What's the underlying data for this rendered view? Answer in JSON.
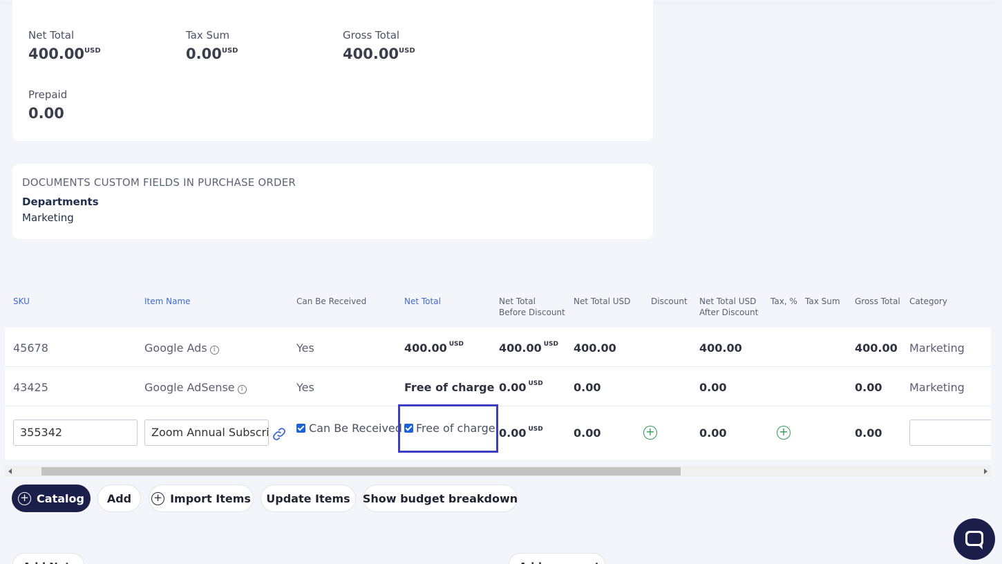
{
  "totals": {
    "net_total": {
      "label": "Net Total",
      "value": "400.00",
      "currency": "USD"
    },
    "tax_sum": {
      "label": "Tax Sum",
      "value": "0.00",
      "currency": "USD"
    },
    "gross_total": {
      "label": "Gross Total",
      "value": "400.00",
      "currency": "USD"
    },
    "prepaid": {
      "label": "Prepaid",
      "value": "0.00"
    }
  },
  "custom_fields": {
    "title": "DOCUMENTS CUSTOM FIELDS IN PURCHASE ORDER",
    "field_label": "Departments",
    "field_value": "Marketing"
  },
  "table": {
    "headers": {
      "sku": "SKU",
      "item_name": "Item Name",
      "can_be_received": "Can Be Received",
      "net_total": "Net Total",
      "net_total_before_discount_1": "Net Total",
      "net_total_before_discount_2": "Before Discount",
      "net_total_usd": "Net Total USD",
      "discount": "Discount",
      "net_total_usd_after_1": "Net Total USD",
      "net_total_usd_after_2": "After Discount",
      "tax_pct": "Tax, %",
      "tax_sum": "Tax Sum",
      "gross_total": "Gross Total",
      "category": "Category"
    },
    "rows": [
      {
        "sku": "45678",
        "item_name": "Google Ads",
        "can_be_received": "Yes",
        "net_total": "400.00",
        "net_total_cur": "USD",
        "before_discount": "400.00",
        "before_discount_cur": "USD",
        "net_total_usd": "400.00",
        "after_discount": "400.00",
        "gross_total": "400.00",
        "category": "Marketing"
      },
      {
        "sku": "43425",
        "item_name": "Google AdSense",
        "can_be_received": "Yes",
        "net_total": "Free of charge",
        "before_discount": "0.00",
        "before_discount_cur": "USD",
        "net_total_usd": "0.00",
        "after_discount": "0.00",
        "gross_total": "0.00",
        "category": "Marketing"
      }
    ],
    "edit_row": {
      "sku_value": "355342",
      "item_name_value": "Zoom Annual Subscri",
      "can_be_received_label": "Can Be Received",
      "can_be_received_checked": true,
      "free_of_charge_label": "Free of charge",
      "free_of_charge_checked": true,
      "before_discount": "0.00",
      "before_discount_cur": "USD",
      "net_total_usd": "0.00",
      "after_discount": "0.00",
      "gross_total": "0.00",
      "category_value": ""
    }
  },
  "actions": {
    "catalog": "Catalog",
    "add": "Add",
    "import_items": "Import Items",
    "update_items": "Update Items",
    "show_budget_breakdown": "Show budget breakdown"
  },
  "bottom": {
    "add_note": "Add Note",
    "add_comment": "Add comment"
  },
  "colors": {
    "primary": "#1c1f4a",
    "link": "#3e6ad1",
    "highlight": "#3b3fc0",
    "success": "#2f9a55"
  }
}
